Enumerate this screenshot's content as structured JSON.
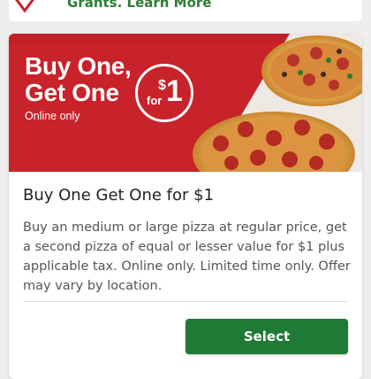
{
  "top_card": {
    "text": "Grants. Learn More"
  },
  "promo": {
    "banner": {
      "line1": "Buy One,",
      "line2": "Get One",
      "subtext": "Online only",
      "badge_for": "for",
      "badge_dollar": "$",
      "badge_amount": "1"
    },
    "title": "Buy One Get One for $1",
    "description": "Buy an medium or large pizza at regular price, get a second pizza of equal or lesser value for $1 plus applicable tax. Online only. Limited time only. Offer may vary by location.",
    "select_label": "Select"
  },
  "colors": {
    "brand_red": "#c8222a",
    "button_green": "#1f7a35",
    "link_green": "#2e7d32"
  }
}
